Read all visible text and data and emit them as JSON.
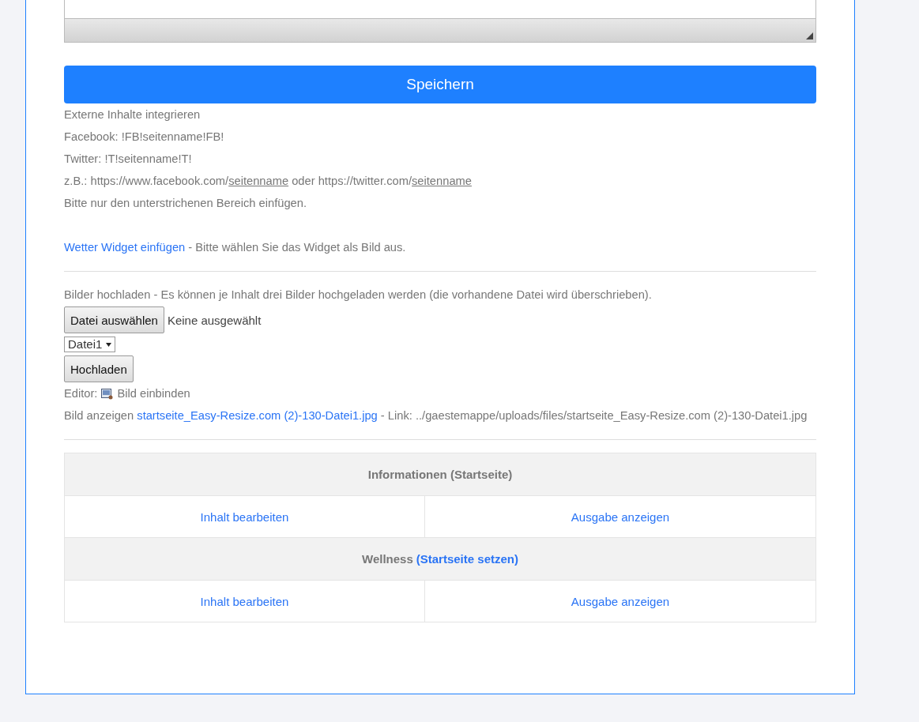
{
  "save_button": "Speichern",
  "embed": {
    "heading": "Externe Inhalte integrieren",
    "facebook": "Facebook: !FB!seitenname!FB!",
    "twitter": "Twitter: !T!seitenname!T!",
    "example": [
      {
        "text": "z.B.: https://www.facebook.com/",
        "underlined": false
      },
      {
        "text": "seitenname",
        "underlined": true
      },
      {
        "text": " oder https://twitter.com/",
        "underlined": false
      },
      {
        "text": "seitenname",
        "underlined": true
      }
    ],
    "hint": "Bitte nur den unterstrichenen Bereich einfügen."
  },
  "weather": {
    "link": "Wetter Widget einfügen",
    "text": " - Bitte wählen Sie das Widget als Bild aus."
  },
  "upload": {
    "intro": "Bilder hochladen - Es können je Inhalt drei Bilder hochgeladen werden (die vorhandene Datei wird überschrieben).",
    "choose_button": "Datei auswählen",
    "no_file": "Keine ausgewählt",
    "slot_select": "Datei1",
    "upload_button": "Hochladen",
    "editor_label": "Editor:",
    "editor_link": "Bild einbinden",
    "show_label": "Bild anzeigen ",
    "image_link": "startseite_Easy-Resize.com (2)-130-Datei1.jpg",
    "link_text": " - Link: ../gaestemappe/uploads/files/startseite_Easy-Resize.com (2)-130-Datei1.jpg"
  },
  "pages": [
    {
      "title": "Informationen (Startseite)",
      "actions": [
        "Inhalt bearbeiten",
        "Ausgabe anzeigen"
      ]
    },
    {
      "title": "Wellness",
      "title_link": "(Startseite setzen)",
      "actions": [
        "Inhalt bearbeiten",
        "Ausgabe anzeigen"
      ]
    }
  ]
}
